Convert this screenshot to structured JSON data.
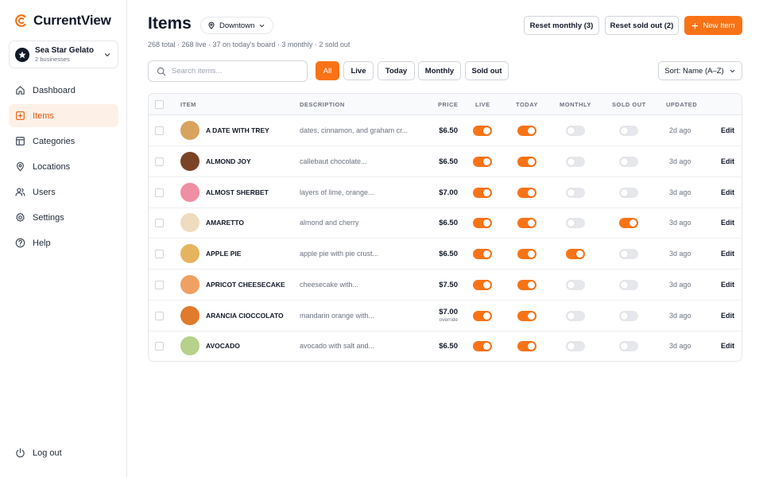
{
  "app": {
    "brand": "CurrentView",
    "accent": "#f97316"
  },
  "business": {
    "name": "Sea Star Gelato",
    "subtitle": "2 businesses"
  },
  "sidebar": {
    "items": [
      {
        "label": "Dashboard",
        "icon": "home-icon"
      },
      {
        "label": "Items",
        "icon": "plus-square-icon"
      },
      {
        "label": "Categories",
        "icon": "layout-icon"
      },
      {
        "label": "Locations",
        "icon": "map-pin-icon"
      },
      {
        "label": "Users",
        "icon": "users-icon"
      },
      {
        "label": "Settings",
        "icon": "gear-icon"
      },
      {
        "label": "Help",
        "icon": "help-circle-icon"
      }
    ],
    "active": "Items",
    "logout": "Log out"
  },
  "header": {
    "title": "Items",
    "location": "Downtown",
    "stats": "268 total · 268 live · 37 on today's board · 3 monthly · 2 sold out",
    "reset_monthly": "Reset monthly (3)",
    "reset_sold_out": "Reset sold out (2)",
    "new_item": "New Item"
  },
  "toolbar": {
    "search_placeholder": "Search items...",
    "filters": [
      "All",
      "Live",
      "Today",
      "Monthly",
      "Sold out"
    ],
    "active_filter": "All",
    "sort": "Sort: Name (A–Z)"
  },
  "table": {
    "columns": [
      "ITEM",
      "DESCRIPTION",
      "PRICE",
      "LIVE",
      "TODAY",
      "MONTHLY",
      "SOLD OUT",
      "UPDATED"
    ],
    "edit_label": "Edit",
    "rows": [
      {
        "name": "A DATE WITH TREY",
        "description": "dates, cinnamon, and graham cr...",
        "price": "$6.50",
        "price_note": "",
        "color": "#d8a35e",
        "live": true,
        "today": true,
        "monthly": false,
        "sold_out": false,
        "updated": "2d ago"
      },
      {
        "name": "ALMOND JOY",
        "description": "callebaut chocolate...",
        "price": "$6.50",
        "price_note": "",
        "color": "#7a4326",
        "live": true,
        "today": true,
        "monthly": false,
        "sold_out": false,
        "updated": "3d ago"
      },
      {
        "name": "ALMOST SHERBET",
        "description": "layers of lime, orange...",
        "price": "$7.00",
        "price_note": "",
        "color": "#ef8fa3",
        "live": true,
        "today": true,
        "monthly": false,
        "sold_out": false,
        "updated": "3d ago"
      },
      {
        "name": "AMARETTO",
        "description": "almond and cherry",
        "price": "$6.50",
        "price_note": "",
        "color": "#efdcbf",
        "live": true,
        "today": true,
        "monthly": false,
        "sold_out": true,
        "updated": "3d ago"
      },
      {
        "name": "APPLE PIE",
        "description": "apple pie with pie crust...",
        "price": "$6.50",
        "price_note": "",
        "color": "#e6b45e",
        "live": true,
        "today": true,
        "monthly": true,
        "sold_out": false,
        "updated": "3d ago"
      },
      {
        "name": "APRICOT CHEESECAKE",
        "description": "cheesecake with...",
        "price": "$7.50",
        "price_note": "",
        "color": "#f0a063",
        "live": true,
        "today": true,
        "monthly": false,
        "sold_out": false,
        "updated": "3d ago"
      },
      {
        "name": "ARANCIA CIOCCOLATO",
        "description": "mandarin orange with...",
        "price": "$7.00",
        "price_note": "override",
        "color": "#e07a2c",
        "live": true,
        "today": true,
        "monthly": false,
        "sold_out": false,
        "updated": "3d ago"
      },
      {
        "name": "AVOCADO",
        "description": "avocado with salt and...",
        "price": "$6.50",
        "price_note": "",
        "color": "#b6d18a",
        "live": true,
        "today": true,
        "monthly": false,
        "sold_out": false,
        "updated": "3d ago"
      }
    ]
  }
}
